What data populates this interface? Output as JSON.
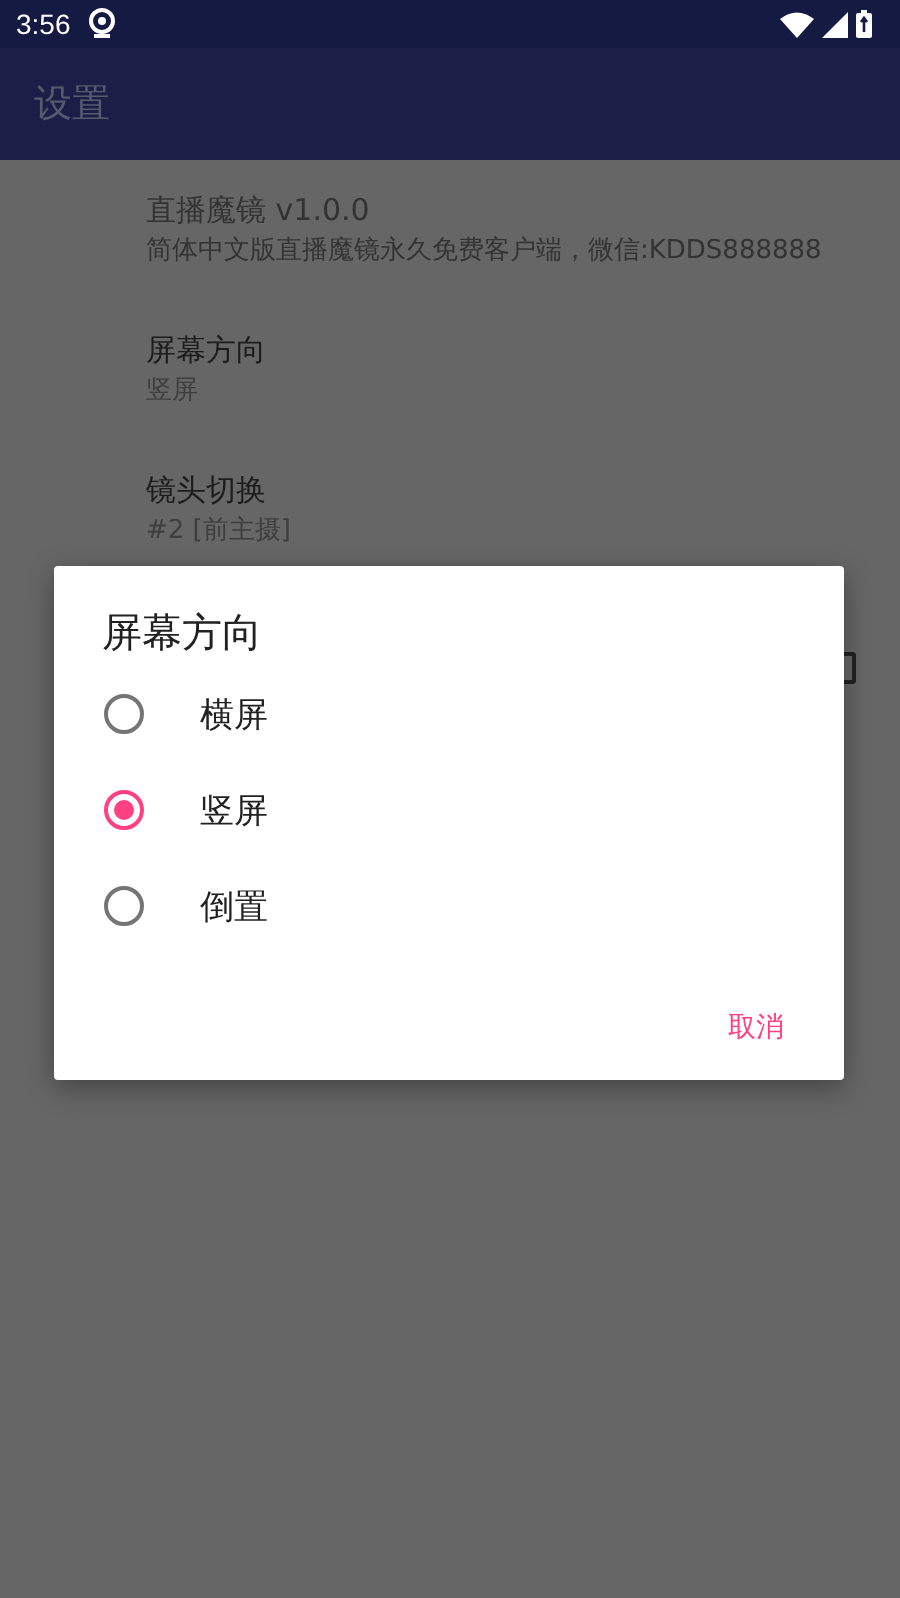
{
  "status_bar": {
    "time": "3:56"
  },
  "toolbar": {
    "title": "设置"
  },
  "settings": [
    {
      "title": "直播魔镜 v1.0.0",
      "summary": "简体中文版直播魔镜永久免费客户端，微信:KDDS888888",
      "disabled": true
    },
    {
      "title": "屏幕方向",
      "summary": "竖屏",
      "disabled": false
    },
    {
      "title": "镜头切换",
      "summary": "#2 [前主摄]",
      "disabled": false
    }
  ],
  "hidden_row": {
    "kind": "checkbox"
  },
  "dialog": {
    "title": "屏幕方向",
    "options": [
      {
        "label": "横屏",
        "selected": false
      },
      {
        "label": "竖屏",
        "selected": true
      },
      {
        "label": "倒置",
        "selected": false
      }
    ],
    "buttons": [
      "取消"
    ]
  }
}
